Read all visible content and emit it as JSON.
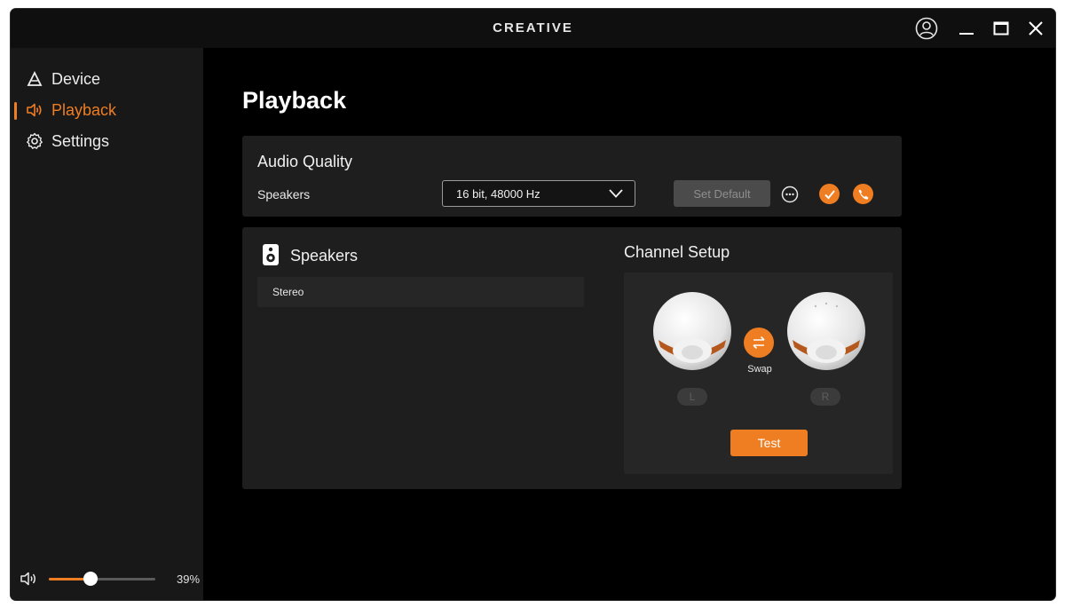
{
  "app": {
    "brand": "CREATIVE"
  },
  "titlebar": {
    "account_icon": "user-circle-icon",
    "minimize_icon": "minimize-icon",
    "maximize_icon": "maximize-icon",
    "close_icon": "close-icon"
  },
  "sidebar": {
    "items": [
      {
        "label": "Device",
        "icon": "device-icon",
        "active": false
      },
      {
        "label": "Playback",
        "icon": "speaker-sound-icon",
        "active": true
      },
      {
        "label": "Settings",
        "icon": "gear-icon",
        "active": false
      }
    ],
    "volume": {
      "percent_label": "39%",
      "level": 0.39
    }
  },
  "page": {
    "title": "Playback"
  },
  "audio_quality": {
    "title": "Audio Quality",
    "device_label": "Speakers",
    "format_selected": "16 bit, 48000 Hz",
    "set_default_label": "Set Default",
    "more_icon": "more-options-icon",
    "default_device_icon": "check-circle-icon",
    "default_comm_icon": "phone-icon"
  },
  "speakers": {
    "title": "Speakers",
    "configs": [
      "Stereo"
    ]
  },
  "channel_setup": {
    "title": "Channel Setup",
    "left_label": "L",
    "right_label": "R",
    "swap_label": "Swap",
    "test_label": "Test"
  },
  "colors": {
    "accent": "#ef7d22",
    "background": "#000000",
    "panel": "#1e1e1e",
    "sidebar": "#181818"
  }
}
